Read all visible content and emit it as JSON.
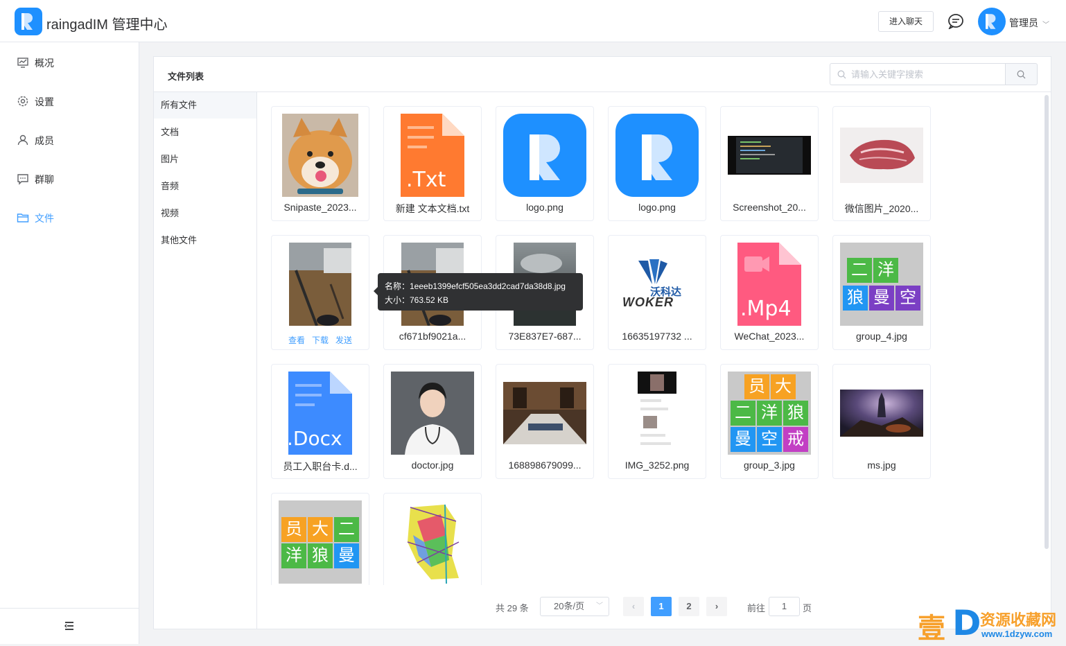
{
  "header": {
    "app_title": "raingadIM 管理中心",
    "enter_chat_label": "进入聊天",
    "admin_name": "管理员",
    "brand_color": "#1e90ff"
  },
  "sidebar": {
    "items": [
      {
        "label": "概况",
        "icon": "dashboard-icon"
      },
      {
        "label": "设置",
        "icon": "gear-icon"
      },
      {
        "label": "成员",
        "icon": "user-icon"
      },
      {
        "label": "群聊",
        "icon": "chat-icon"
      },
      {
        "label": "文件",
        "icon": "folder-icon",
        "active": true
      }
    ],
    "active_color": "#409eff"
  },
  "panel": {
    "title": "文件列表",
    "search_placeholder": "请输入关键字搜索"
  },
  "categories": [
    "所有文件",
    "文档",
    "图片",
    "音频",
    "视频",
    "其他文件"
  ],
  "files": [
    {
      "name": "Snipaste_2023...",
      "kind": "shiba-photo"
    },
    {
      "name": "新建 文本文档.txt",
      "kind": "txt-icon",
      "badge": ".Txt"
    },
    {
      "name": "logo.png",
      "kind": "logo"
    },
    {
      "name": "logo.png",
      "kind": "logo"
    },
    {
      "name": "Screenshot_20...",
      "kind": "screenshot"
    },
    {
      "name": "微信图片_2020...",
      "kind": "meat-photo"
    },
    {
      "name": "",
      "kind": "floor-photo",
      "hovered": true
    },
    {
      "name": "cf671bf9021a...",
      "kind": "floor-photo"
    },
    {
      "name": "73E837E7-687...",
      "kind": "sky-photo"
    },
    {
      "name": "16635197732 ...",
      "kind": "woker-logo",
      "logo_text": "沃科达",
      "logo_sub": "WOKER"
    },
    {
      "name": "WeChat_2023...",
      "kind": "mp4-icon",
      "badge": ".Mp4"
    },
    {
      "name": "group_4.jpg",
      "kind": "group-grid",
      "chars": [
        "二",
        "洋",
        "狼",
        "曼",
        "空"
      ]
    },
    {
      "name": "员工入职台卡.d...",
      "kind": "docx-icon",
      "badge": ".Docx"
    },
    {
      "name": "doctor.jpg",
      "kind": "doctor-photo"
    },
    {
      "name": "168898679099...",
      "kind": "room-photo"
    },
    {
      "name": "IMG_3252.png",
      "kind": "phone-screenshot"
    },
    {
      "name": "group_3.jpg",
      "kind": "group-grid",
      "chars": [
        "员",
        "大",
        "二",
        "洋",
        "狼",
        "曼",
        "空",
        "戒"
      ]
    },
    {
      "name": "ms.jpg",
      "kind": "game-photo"
    },
    {
      "name": "",
      "kind": "group-grid",
      "chars": [
        "员",
        "大",
        "二",
        "洋",
        "狼",
        "曼"
      ]
    },
    {
      "name": "",
      "kind": "map-image"
    }
  ],
  "card_actions": {
    "view": "查看",
    "download": "下载",
    "send": "发送"
  },
  "tooltip": {
    "name_line": "名称：1eeeb1399efcf505ea3dd2cad7da38d8.jpg",
    "size_line": "大小：763.52 KB"
  },
  "pagination": {
    "total_text": "共 29 条",
    "page_size": "20条/页",
    "pages": [
      "1",
      "2"
    ],
    "current_page": "1",
    "goto_label": "前往",
    "goto_value": "1",
    "goto_unit": "页"
  },
  "watermark": {
    "big_char": "壹",
    "d_char": "D",
    "text": "资源收藏网",
    "url": "www.1dzyw.com"
  }
}
